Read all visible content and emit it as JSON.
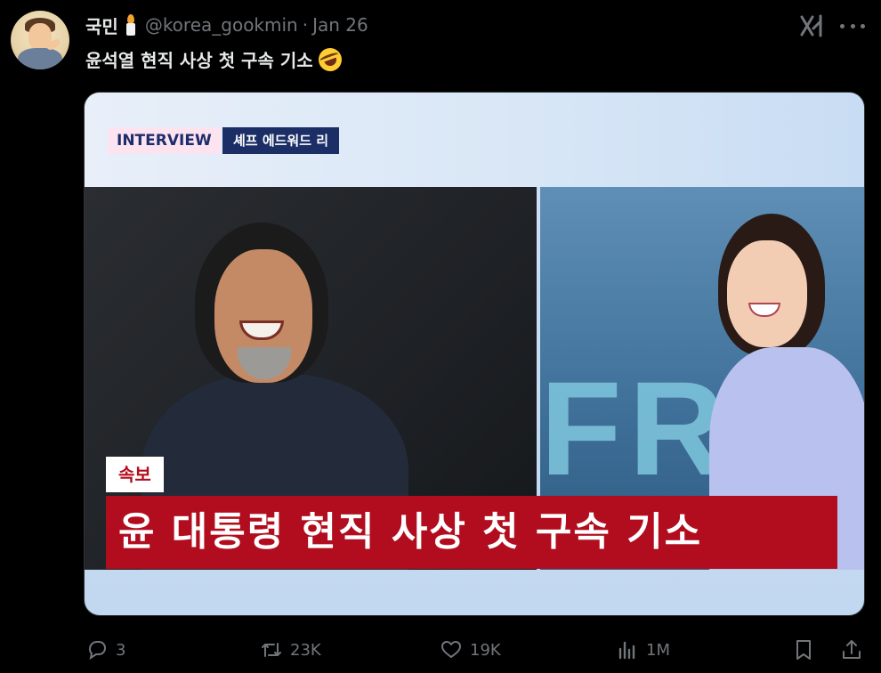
{
  "tweet": {
    "display_name": "국민",
    "handle": "@korea_gookmin",
    "separator": "·",
    "date": "Jan 26",
    "text": "윤석열 현직 사상 첫 구속 기소",
    "emoji": "rolling-on-the-floor-laughing-emoji"
  },
  "media": {
    "interview_tag": "INTERVIEW",
    "guest_name": "셰프 에드워드 리",
    "breaking_tag": "속보",
    "headline": "윤 대통령 현직 사상 첫 구속 기소",
    "background_text": "FRI"
  },
  "actions": {
    "replies": "3",
    "reposts": "23K",
    "likes": "19K",
    "views": "1M"
  },
  "icons": {
    "verified_badge": "candle-icon",
    "grok": "grok-icon",
    "more": "more-icon",
    "reply": "reply-icon",
    "repost": "repost-icon",
    "like": "heart-icon",
    "views": "views-icon",
    "bookmark": "bookmark-icon",
    "share": "share-icon"
  },
  "colors": {
    "background": "#000000",
    "text": "#e7e9ea",
    "muted": "#71767b",
    "headline_red": "#b10d1e",
    "tag_navy": "#1b2e66"
  }
}
